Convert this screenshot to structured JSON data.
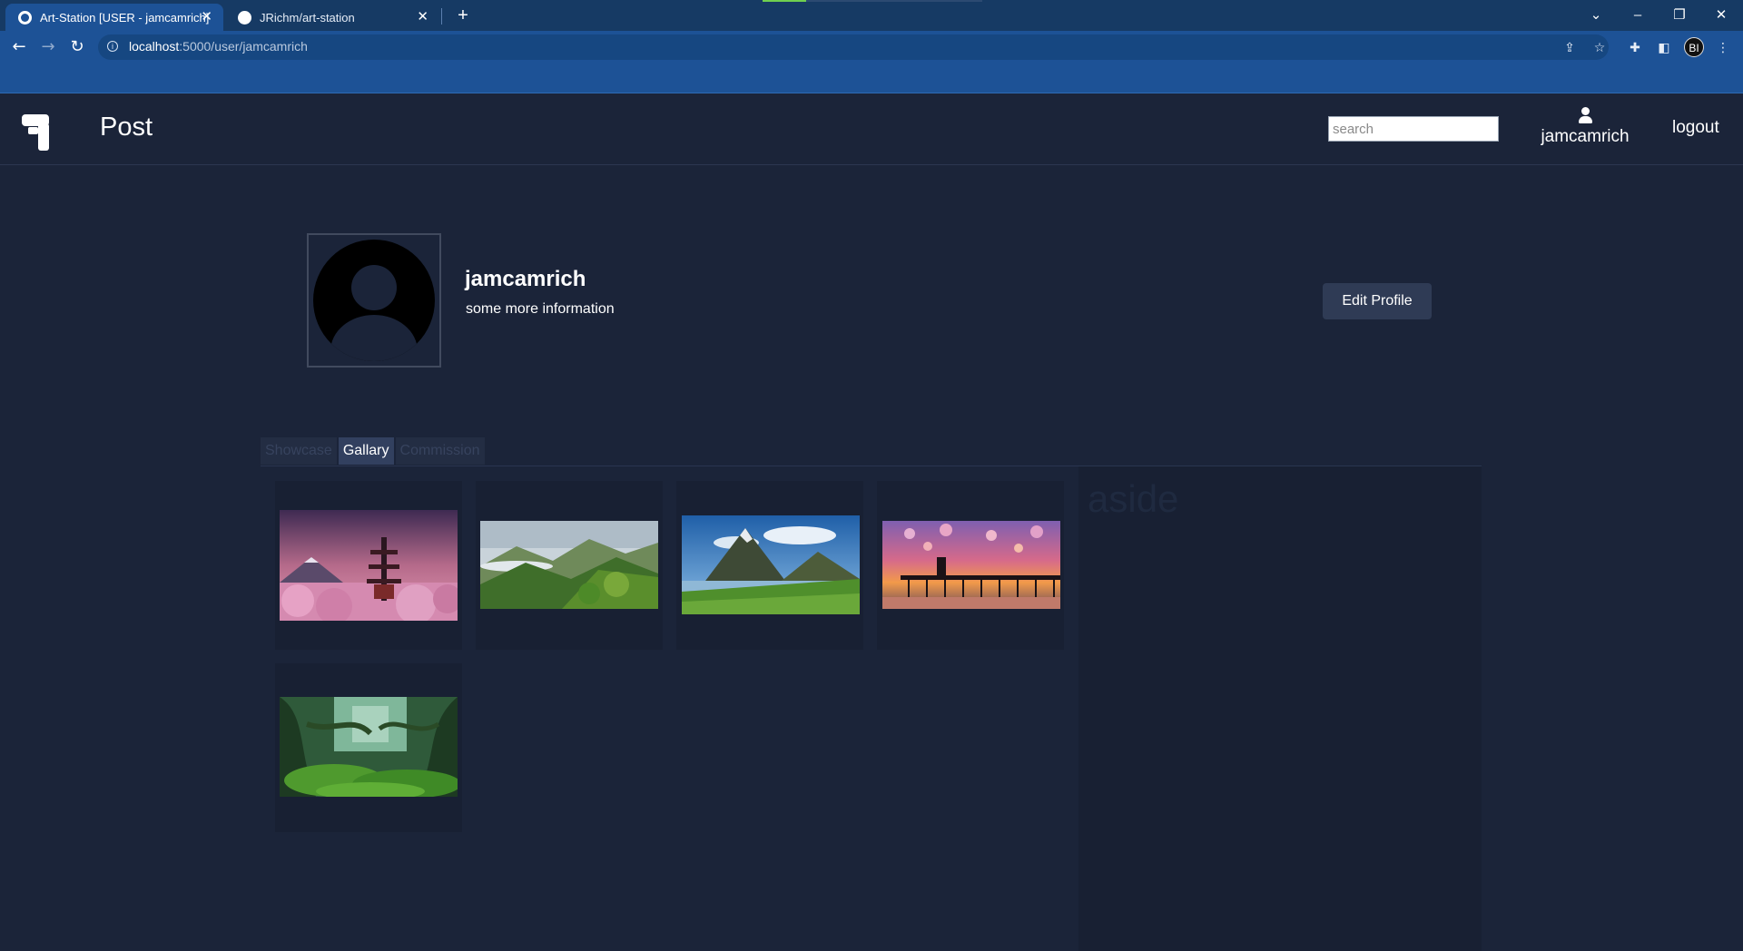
{
  "browser": {
    "tabs": [
      {
        "title": "Art-Station [USER - jamcamrich]",
        "active": true
      },
      {
        "title": "JRichm/art-station",
        "active": false
      }
    ],
    "url_host": "localhost",
    "url_path": ":5000/user/jamcamrich",
    "profile_initials": "BI",
    "accent": "#1d5296"
  },
  "nav": {
    "brand_icon": "paint-roller-icon",
    "post_label": "Post",
    "search_placeholder": "search",
    "search_value": "",
    "username": "jamcamrich",
    "logout_label": "logout"
  },
  "profile": {
    "username": "jamcamrich",
    "info": "some more information",
    "edit_label": "Edit Profile"
  },
  "tabs": [
    {
      "label": "Showcase",
      "active": false
    },
    {
      "label": "Gallary",
      "active": true
    },
    {
      "label": "Commission",
      "active": false
    }
  ],
  "gallery": [
    {
      "subject": "pagoda with cherry blossoms and mountain"
    },
    {
      "subject": "misty green mountains"
    },
    {
      "subject": "mountain peak above lake"
    },
    {
      "subject": "pier at sunset"
    },
    {
      "subject": "mossy green forest"
    }
  ],
  "aside": {
    "title": "aside"
  },
  "colors": {
    "background": "#1b2439",
    "card": "#182033",
    "button": "#2f3b55"
  }
}
